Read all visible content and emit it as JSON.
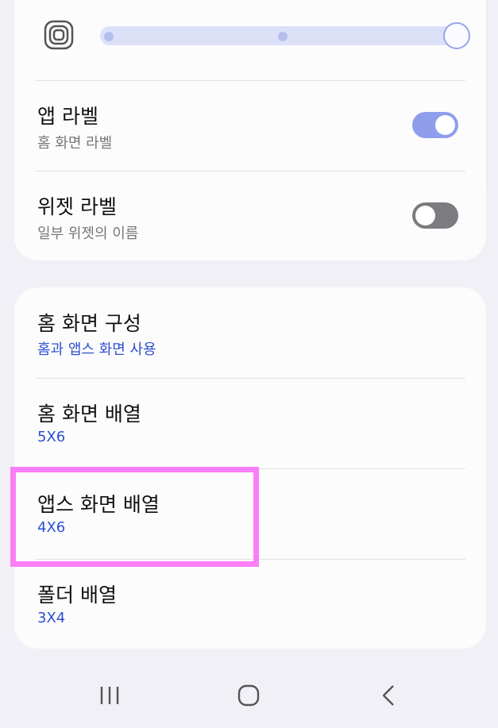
{
  "card1": {
    "app_label": {
      "title": "앱 라벨",
      "subtitle": "홈 화면 라벨",
      "enabled": true
    },
    "widget_label": {
      "title": "위젯 라벨",
      "subtitle": "일부 위젯의 이름",
      "enabled": false
    }
  },
  "card2": {
    "items": [
      {
        "title": "홈 화면 구성",
        "value": "홈과 앱스 화면 사용"
      },
      {
        "title": "홈 화면 배열",
        "value": "5X6"
      },
      {
        "title": "앱스 화면 배열",
        "value": "4X6"
      },
      {
        "title": "폴더 배열",
        "value": "3X4"
      }
    ]
  },
  "icons": {
    "icon_size": "app-icon-size-icon",
    "recents": "recent-apps-icon",
    "home": "home-icon",
    "back": "back-icon"
  },
  "colors": {
    "accent": "#8e9eed",
    "value_blue": "#2d4fd1",
    "highlight": "#fb7ef7"
  }
}
